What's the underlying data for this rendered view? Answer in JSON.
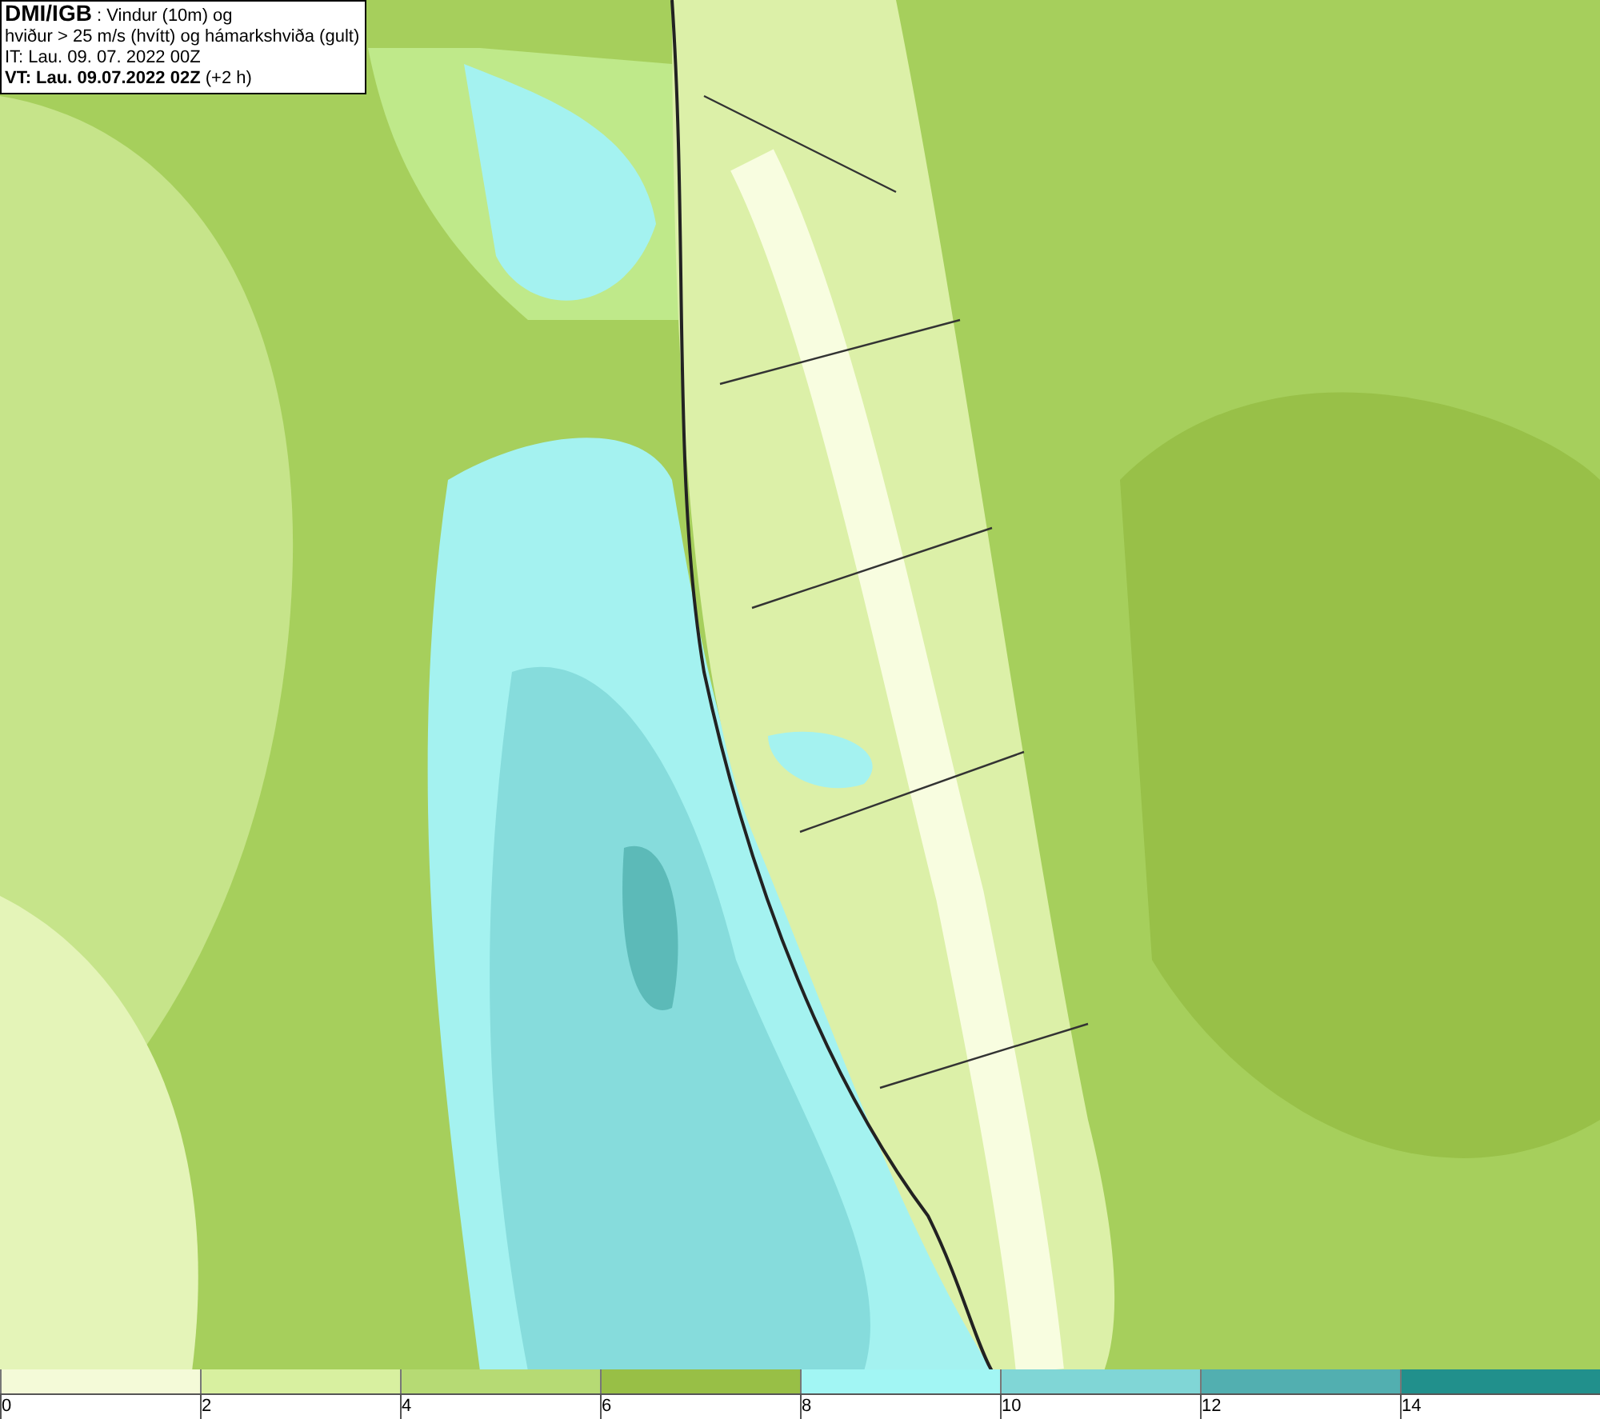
{
  "info_box": {
    "lines": [
      "**DMI/IGB** : Vindur (10m) og",
      "hviður > 25 m/s (hvítt) og hámarkshviða (gult)",
      "IT: Lau. 09. 07. 2022 00Z",
      "**VT: Lau. 09.07.2022 02Z** (+2 h)"
    ]
  },
  "legend": [
    {
      "label": "0",
      "color": "#f4fad8"
    },
    {
      "label": "2",
      "color": "#d8f0a0"
    },
    {
      "label": "4",
      "color": "#b6da74"
    },
    {
      "label": "6",
      "color": "#98bf46"
    },
    {
      "label": "8",
      "color": "#a2f6f4"
    },
    {
      "label": "10",
      "color": "#80d6d6"
    },
    {
      "label": "12",
      "color": "#52afb0"
    },
    {
      "label": "14",
      "color": "#21908c"
    }
  ]
}
